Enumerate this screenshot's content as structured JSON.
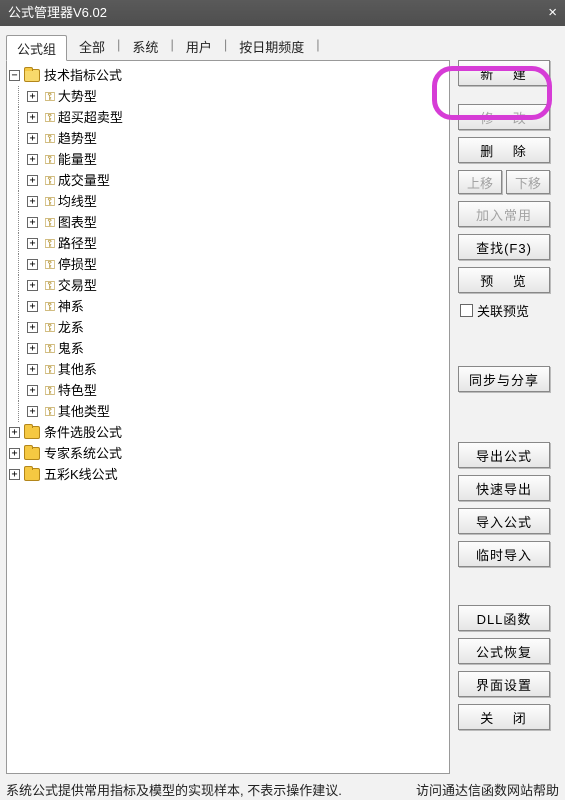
{
  "window": {
    "title": "公式管理器V6.02",
    "close_glyph": "×"
  },
  "tabs": [
    {
      "label": "公式组",
      "active": true
    },
    {
      "label": "全部"
    },
    {
      "label": "系统"
    },
    {
      "label": "用户"
    },
    {
      "label": "按日期频度"
    }
  ],
  "tree": {
    "root": [
      {
        "label": "技术指标公式",
        "open": true,
        "children": [
          {
            "label": "大势型"
          },
          {
            "label": "超买超卖型"
          },
          {
            "label": "趋势型"
          },
          {
            "label": "能量型"
          },
          {
            "label": "成交量型"
          },
          {
            "label": "均线型"
          },
          {
            "label": "图表型"
          },
          {
            "label": "路径型"
          },
          {
            "label": "停损型"
          },
          {
            "label": "交易型"
          },
          {
            "label": "神系"
          },
          {
            "label": "龙系"
          },
          {
            "label": "鬼系"
          },
          {
            "label": "其他系"
          },
          {
            "label": "特色型"
          },
          {
            "label": "其他类型"
          }
        ]
      },
      {
        "label": "条件选股公式"
      },
      {
        "label": "专家系统公式"
      },
      {
        "label": "五彩K线公式"
      }
    ]
  },
  "buttons": {
    "new": "新  建",
    "modify": "修  改",
    "delete": "删  除",
    "move_up": "上移",
    "move_down": "下移",
    "add_favorite": "加入常用",
    "find": "查找(F3)",
    "preview": "预  览",
    "link_preview": "关联预览",
    "sync_share": "同步与分享",
    "export_formula": "导出公式",
    "quick_export": "快速导出",
    "import_formula": "导入公式",
    "temp_import": "临时导入",
    "dll_func": "DLL函数",
    "formula_recover": "公式恢复",
    "ui_settings": "界面设置",
    "close": "关  闭"
  },
  "status": {
    "left": "系统公式提供常用指标及模型的实现样本, 不表示操作建议.",
    "right": "访问通达信函数网站帮助"
  },
  "icons": {
    "key": "⚿"
  },
  "expander": {
    "plus": "+",
    "minus": "−"
  }
}
